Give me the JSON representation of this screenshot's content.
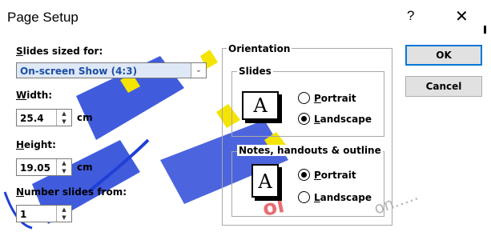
{
  "window": {
    "title": "Page Setup",
    "help_glyph": "?",
    "close_glyph": "✕"
  },
  "slides_sized_for": {
    "label_key": "S",
    "label_rest": "lides sized for:",
    "value": "On-screen Show (4:3)"
  },
  "width": {
    "label_key": "W",
    "label_rest": "idth:",
    "value": "25.4",
    "unit": "cm"
  },
  "height": {
    "label_key": "H",
    "label_rest": "eight:",
    "value": "19.05",
    "unit": "cm"
  },
  "number_slides_from": {
    "label_key": "N",
    "label_rest": "umber slides from:",
    "value": "1"
  },
  "orientation": {
    "title": "Orientation",
    "slides": {
      "title": "Slides",
      "icon_letter": "A",
      "portrait_key": "P",
      "portrait_rest": "ortrait",
      "landscape_key": "L",
      "landscape_rest": "andscape",
      "selected": "Landscape"
    },
    "notes": {
      "title": "Notes, handouts & outline",
      "icon_letter": "A",
      "portrait_key": "P",
      "portrait_rest": "ortrait",
      "landscape_key": "L",
      "landscape_rest": "andscape",
      "selected": "Portrait"
    }
  },
  "buttons": {
    "ok": "OK",
    "cancel": "Cancel"
  },
  "colors": {
    "accent": "#0078d7",
    "selection_bg": "#dfe8f7",
    "watermark_blue": "#1f3fd6",
    "watermark_yellow": "#f5e400",
    "watermark_red": "#e0303a"
  },
  "icons": {
    "dropdown": "chevron-down-icon",
    "spin_up": "spin-up-icon",
    "spin_down": "spin-down-icon"
  }
}
